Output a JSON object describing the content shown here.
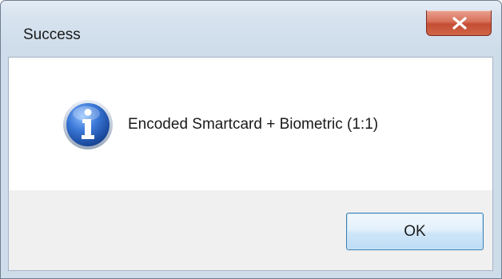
{
  "dialog": {
    "title": "Success",
    "message": "Encoded Smartcard + Biometric (1:1)",
    "icon": "information-icon",
    "ok_label": "OK"
  },
  "colors": {
    "close_button": "#c44d33",
    "ok_border": "#3c7fb1",
    "info_icon_blue": "#1f55b8"
  }
}
